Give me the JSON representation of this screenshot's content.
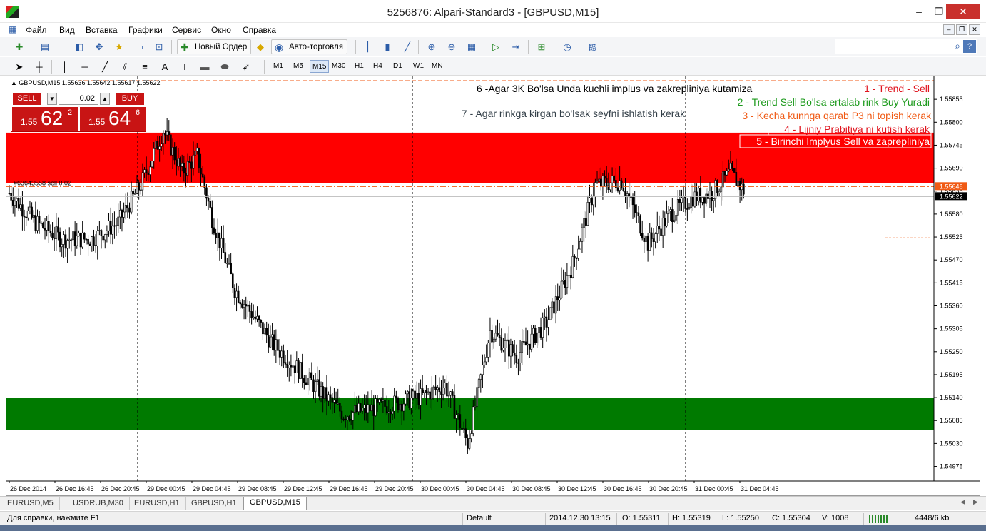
{
  "window": {
    "title": "5256876: Alpari-Standard3 - [GBPUSD,M15]",
    "min": "–",
    "restore": "❐",
    "close": "✕"
  },
  "menu": [
    "Файл",
    "Вид",
    "Вставка",
    "Графики",
    "Сервис",
    "Окно",
    "Справка"
  ],
  "toolbar": {
    "new_order": "Новый Ордер",
    "auto_trading": "Авто-торговля"
  },
  "timeframes": [
    "M1",
    "M5",
    "M15",
    "M30",
    "H1",
    "H4",
    "D1",
    "W1",
    "MN"
  ],
  "active_timeframe": "M15",
  "chart_header": "GBPUSD,M15  1.55636 1.55642 1.55617 1.55622",
  "one_click": {
    "sell_label": "SELL",
    "buy_label": "BUY",
    "lot": "0.02",
    "sell_prefix": "1.55",
    "sell_big": "62",
    "sell_sup": "2",
    "buy_prefix": "1.55",
    "buy_big": "64",
    "buy_sup": "6"
  },
  "order_label": "#63643558 sell 0.02",
  "annotations": [
    {
      "text": "6 -Agar 3K Bo'lsa Unda kuchli implus va zakrepliniya kutamiza",
      "color": "#000000"
    },
    {
      "text": "1 - Trend - Sell",
      "color": "#e0141e"
    },
    {
      "text": "2 - Trend Sell Bo'lsa ertalab rink Buy Yuradi",
      "color": "#1c9a1c"
    },
    {
      "text": "7 - Agar rinkga kirgan bo'lsak seyfni ishlatish kerak",
      "color": "#333f48"
    },
    {
      "text": "3 - Kecha kunnga qarab P3 ni topish kerak",
      "color": "#f05a14"
    },
    {
      "text": "4 - Lijniy Prabitiya ni kutish kerak",
      "color": "#e0141e"
    },
    {
      "text": "5 - Birinchi Implyus Sell va zaprepliniya",
      "color": "#ffffff"
    }
  ],
  "price_scale": [
    "1.55855",
    "1.55800",
    "1.55745",
    "1.55690",
    "1.55635",
    "1.55580",
    "1.55525",
    "1.55470",
    "1.55415",
    "1.55360",
    "1.55305",
    "1.55250",
    "1.55195",
    "1.55140",
    "1.55085",
    "1.55030",
    "1.54975"
  ],
  "current_ask": "1.55646",
  "current_bid": "1.55622",
  "time_scale": [
    "26 Dec 2014",
    "26 Dec 16:45",
    "26 Dec 20:45",
    "29 Dec 00:45",
    "29 Dec 04:45",
    "29 Dec 08:45",
    "29 Dec 12:45",
    "29 Dec 16:45",
    "29 Dec 20:45",
    "30 Dec 00:45",
    "30 Dec 04:45",
    "30 Dec 08:45",
    "30 Dec 12:45",
    "30 Dec 16:45",
    "30 Dec 20:45",
    "31 Dec 00:45",
    "31 Dec 04:45"
  ],
  "chart_tabs": [
    "EURUSD,M5",
    "USDRUB,M30",
    "EURUSD,H1",
    "GBPUSD,H1",
    "GBPUSD,M15"
  ],
  "active_chart_tab": "GBPUSD,M15",
  "status": {
    "help": "Для справки, нажмите F1",
    "profile": "Default",
    "time": "2014.12.30 13:15",
    "open": "O: 1.55311",
    "high": "H: 1.55319",
    "low": "L: 1.55250",
    "close": "C: 1.55304",
    "volume": "V: 1008",
    "traffic": "4448/6 kb"
  },
  "colors": {
    "resistance_zone": "#ff0000",
    "support_zone": "#007a00",
    "candle": "#000000"
  },
  "chart_data": {
    "type": "candlestick",
    "symbol": "GBPUSD",
    "timeframe": "M15",
    "ylim": [
      1.5494,
      1.5591
    ],
    "zones": [
      {
        "from": 1.55655,
        "to": 1.55775,
        "color": "#ff0000"
      },
      {
        "from": 1.55063,
        "to": 1.55139,
        "color": "#007a00"
      }
    ],
    "levels": [
      1.55646,
      1.55622
    ],
    "close_path": [
      [
        0,
        1.5563
      ],
      [
        14,
        1.5556
      ],
      [
        28,
        1.5552
      ],
      [
        44,
        1.5552
      ],
      [
        58,
        1.5556
      ],
      [
        70,
        1.5565
      ],
      [
        82,
        1.5578
      ],
      [
        92,
        1.5568
      ],
      [
        100,
        1.5572
      ],
      [
        108,
        1.5557
      ],
      [
        120,
        1.554
      ],
      [
        140,
        1.5527
      ],
      [
        160,
        1.5518
      ],
      [
        178,
        1.551
      ],
      [
        200,
        1.5512
      ],
      [
        218,
        1.5514
      ],
      [
        232,
        1.5517
      ],
      [
        244,
        1.5503
      ],
      [
        256,
        1.553
      ],
      [
        270,
        1.5524
      ],
      [
        286,
        1.5532
      ],
      [
        300,
        1.5546
      ],
      [
        312,
        1.5565
      ],
      [
        326,
        1.5566
      ],
      [
        340,
        1.5551
      ],
      [
        352,
        1.5558
      ],
      [
        364,
        1.5562
      ],
      [
        374,
        1.5563
      ],
      [
        384,
        1.5568
      ],
      [
        392,
        1.5563
      ]
    ]
  }
}
